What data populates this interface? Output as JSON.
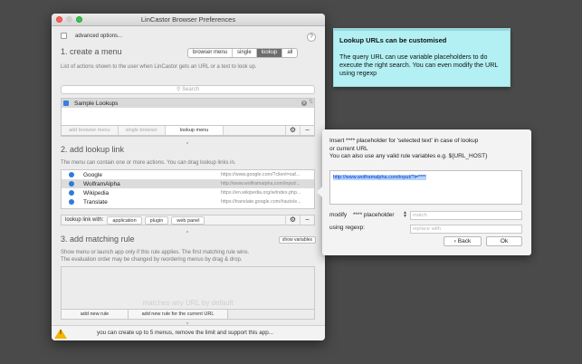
{
  "window": {
    "title": "LinCastor Browser Preferences"
  },
  "advanced": {
    "label": "advanced options...",
    "help": "?"
  },
  "section1": {
    "title": "1. create a menu",
    "description": "List of actions shown to the user when LinCastor gets an URL or a text to look up.",
    "mode_tabs": [
      "browser menu",
      "single",
      "lookup",
      "all"
    ],
    "search_placeholder": "Search",
    "list": [
      {
        "label": "Sample Lookups",
        "checked": true
      }
    ],
    "buttons": {
      "add_browser_menu": "add browser menu",
      "single_browser": "single browser",
      "lookup_menu": "lookup menu"
    }
  },
  "section2": {
    "title": "2. add lookup link",
    "description": "The menu can contain one or more actions. You can drag lookup links in.",
    "links": [
      {
        "name": "Google",
        "url": "https://www.google.com/?client=saf..."
      },
      {
        "name": "WolframAlpha",
        "url": "http://www.wolframalpha.com/input/..."
      },
      {
        "name": "Wikipedia",
        "url": "https://en.wikipedia.org/w/index.php..."
      },
      {
        "name": "Translate",
        "url": "https://translate.google.com/#auto/e..."
      }
    ],
    "lookup_with": {
      "label": "lookup link with:",
      "application": "application",
      "plugin": "plugin",
      "web_panel": "web panel"
    }
  },
  "section3": {
    "title": "3. add matching rule",
    "show_variables": "show variables",
    "description_line1": "Show menu or launch app only if this rule applies. The first matching rule wins.",
    "description_line2": "The evaluation order may be changed by reordering menus by drag & drop.",
    "watermark": "matches any URL by default",
    "add_new_rule": "add new rule",
    "add_new_rule_current": "add new rule for the current URL"
  },
  "footer": {
    "text": "you can create up to 5 menus, remove the limit and support this app..."
  },
  "note": {
    "title": "Lookup URLs can be customised",
    "body": "The query URL can use variable placeholders to do execute the right search. You can even modify the URL using regexp"
  },
  "popover": {
    "line1": "Insert **** placeholder for 'selected text' in case of lookup",
    "line2": "or current URL",
    "line3": "You can also use any valid rule variables e.g. ${URL_HOST}",
    "url_value": "http://www.wolframalpha.com/input/?i=****",
    "modify_label": "modify",
    "placeholder_select": "**** placeholder",
    "match_placeholder": "match",
    "using_regexp_label": "using regexp:",
    "replace_placeholder": "replace with",
    "back_button": "Back",
    "ok_button": "Ok"
  },
  "icons": {
    "gear": "gear-icon",
    "minus": "minus-icon",
    "search": "search-icon",
    "warning": "warning-icon"
  },
  "colors": {
    "accent": "#2f7bd9",
    "selected_tab": "#6d6d6d",
    "note_bg": "#b3f0f3",
    "warning": "#f5b400"
  }
}
